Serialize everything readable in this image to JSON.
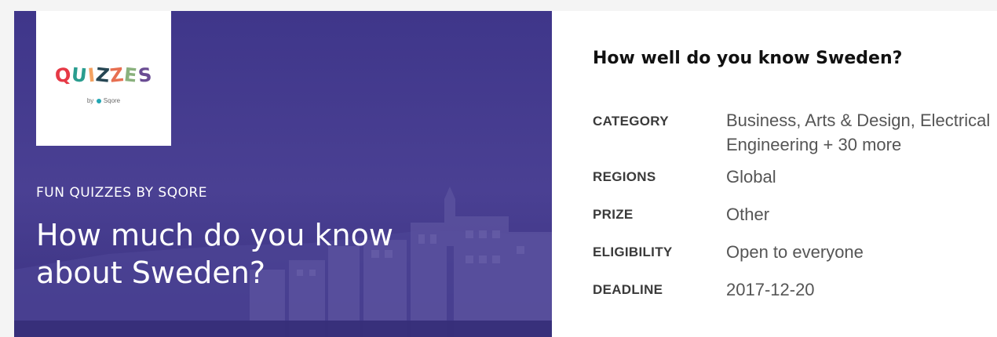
{
  "hero": {
    "logo": {
      "wordmark": "QUIZZES",
      "byline_prefix": "by",
      "byline_brand": "Sqore"
    },
    "kicker": "FUN QUIZZES BY SQORE",
    "headline": "How much do you know about Sweden?"
  },
  "details": {
    "title": "How well do you know Sweden?",
    "rows": [
      {
        "label": "CATEGORY",
        "value": "Business, Arts & Design, Electrical Engineering + 30 more"
      },
      {
        "label": "REGIONS",
        "value": "Global"
      },
      {
        "label": "PRIZE",
        "value": "Other"
      },
      {
        "label": "ELIGIBILITY",
        "value": "Open to everyone"
      },
      {
        "label": "DEADLINE",
        "value": "2017-12-20"
      }
    ]
  },
  "colors": {
    "hero_purple": "#463c8f",
    "logo_letters": [
      "#e63946",
      "#2a9d8f",
      "#f4a261",
      "#264653",
      "#e76f51",
      "#8ab17d",
      "#6a4c93"
    ]
  }
}
